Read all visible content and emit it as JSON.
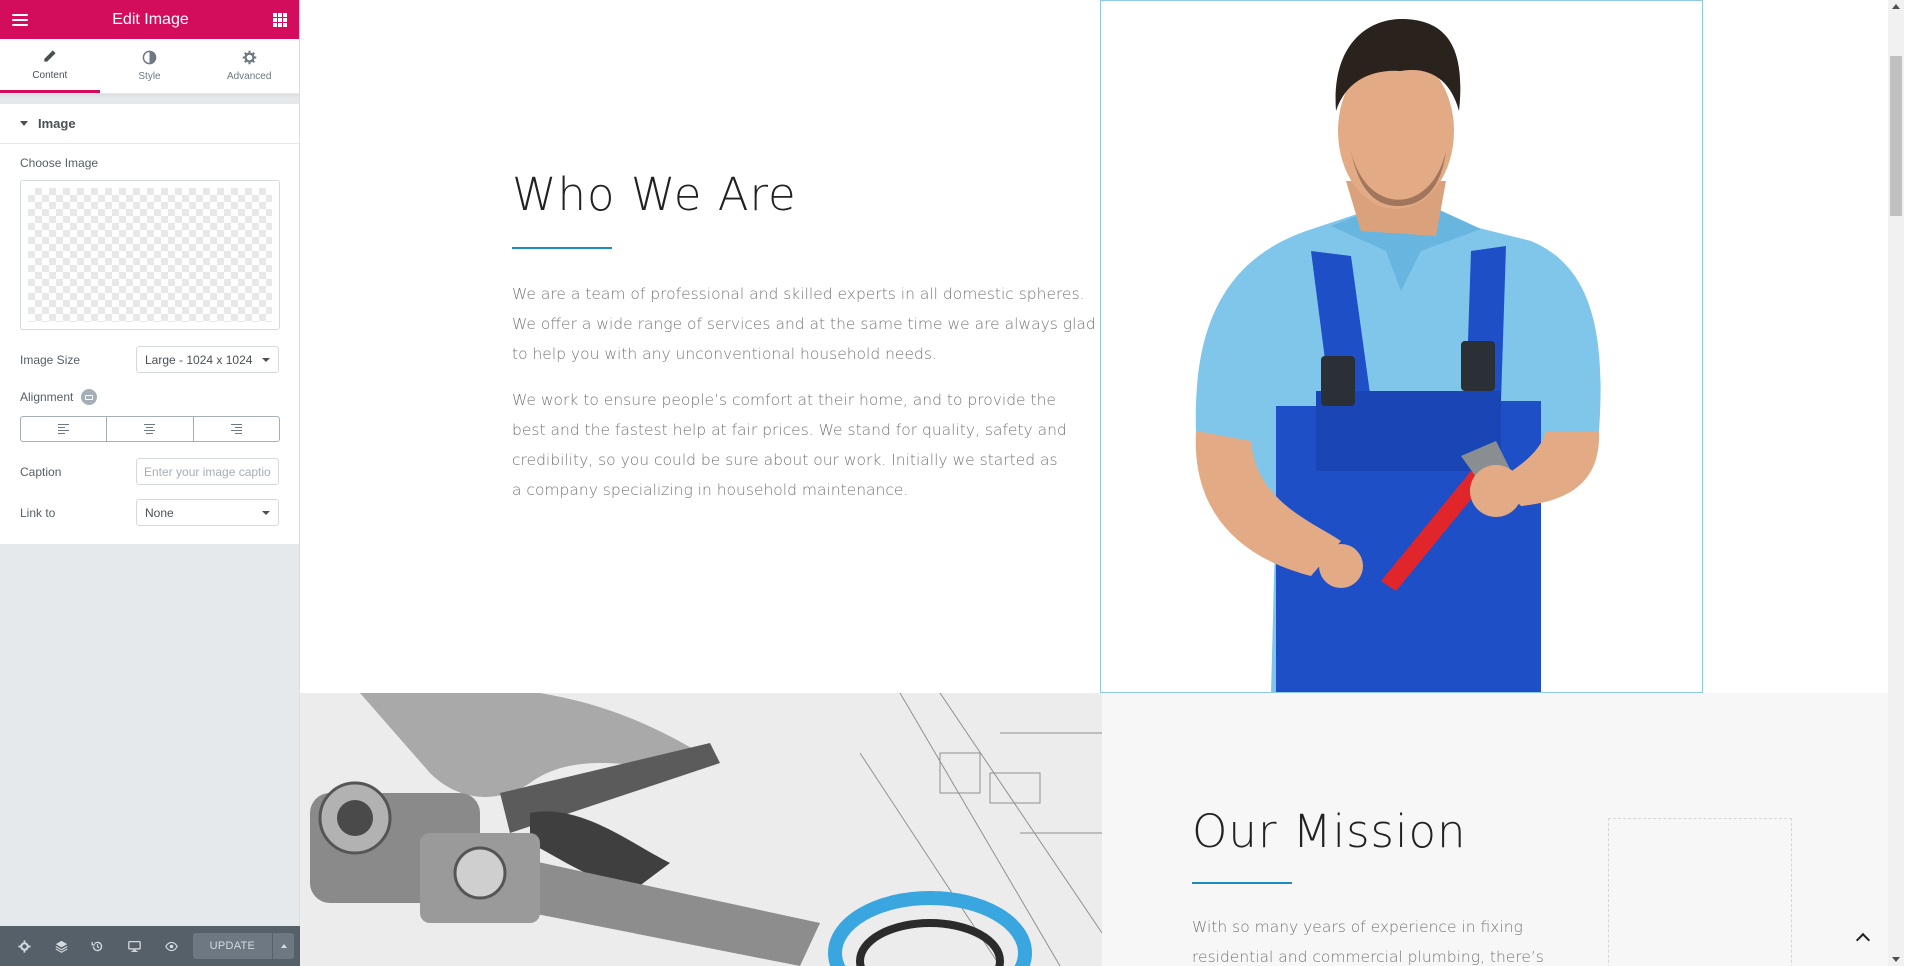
{
  "panel": {
    "title": "Edit Image",
    "tabs": [
      {
        "label": "Content",
        "icon": "pencil-icon"
      },
      {
        "label": "Style",
        "icon": "contrast-icon"
      },
      {
        "label": "Advanced",
        "icon": "gear-icon"
      }
    ],
    "section_title": "Image",
    "choose_image_label": "Choose Image",
    "image_size": {
      "label": "Image Size",
      "value": "Large - 1024 x 1024"
    },
    "alignment": {
      "label": "Alignment",
      "options": [
        "left",
        "center",
        "right"
      ]
    },
    "caption": {
      "label": "Caption",
      "placeholder": "Enter your image caption"
    },
    "link_to": {
      "label": "Link to",
      "value": "None"
    },
    "footer": {
      "update_label": "UPDATE"
    }
  },
  "preview": {
    "who_heading": "Who We Are",
    "who_para1": "We are a team of professional and skilled experts in all domestic spheres. We offer a wide range of services and at the same time we are always glad to help you with any unconventional household needs.",
    "who_para2": "We work to ensure people’s comfort at their home, and to provide the best and the fastest help at fair prices. We stand for quality, safety and credibility, so you could be sure about our work. Initially we started as a company specializing in household maintenance.",
    "mission_heading": "Our Mission",
    "mission_para": "With so many years of experience in fixing residential and commercial plumbing, there’s"
  },
  "colors": {
    "brand": "#d30c5c",
    "accent": "#1e8cbe",
    "footer_bg": "#556068"
  }
}
